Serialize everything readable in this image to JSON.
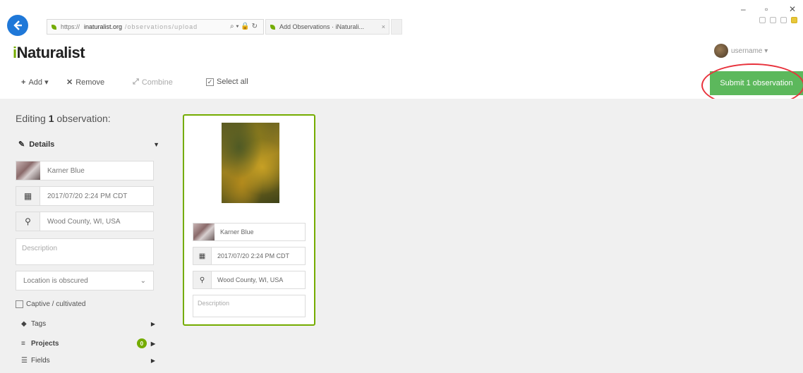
{
  "browser": {
    "url_scheme": "https://",
    "url_domain": "inaturalist.org",
    "url_path": "/observations/upload",
    "addr_controls": "⌕ ▾ 🔒 ↻",
    "tab_title": "Add Observations · iNaturali...",
    "tab_close": "×",
    "minimize": "–",
    "restore": "▫",
    "close": "✕"
  },
  "app": {
    "brand_first": "i",
    "brand_rest": "Naturalist",
    "user_name": "username ▾"
  },
  "toolbar": {
    "add_label": "Add ▾",
    "remove_label": "Remove",
    "combine_label": "Combine",
    "select_all_label": "Select all",
    "submit_label": "Submit 1 observation"
  },
  "sidebar": {
    "editing_prefix": "Editing",
    "editing_count": "1",
    "editing_suffix": "observation:",
    "details_label": "Details",
    "taxon": "Karner Blue",
    "datetime": "2017/07/20 2:24 PM CDT",
    "location": "Wood County, WI, USA",
    "description_placeholder": "Description",
    "geoprivacy": "Location is obscured",
    "captive_label": "Captive / cultivated",
    "tags_label": "Tags",
    "projects_label": "Projects",
    "projects_count": "0",
    "fields_label": "Fields"
  },
  "card": {
    "taxon": "Karner Blue",
    "datetime": "2017/07/20 2:24 PM CDT",
    "location": "Wood County, WI, USA",
    "description_placeholder": "Description"
  },
  "colors": {
    "brand_green": "#74ac00",
    "submit_green": "#5cb85c",
    "highlight_red": "#e8323c",
    "back_blue": "#1f78d8"
  }
}
